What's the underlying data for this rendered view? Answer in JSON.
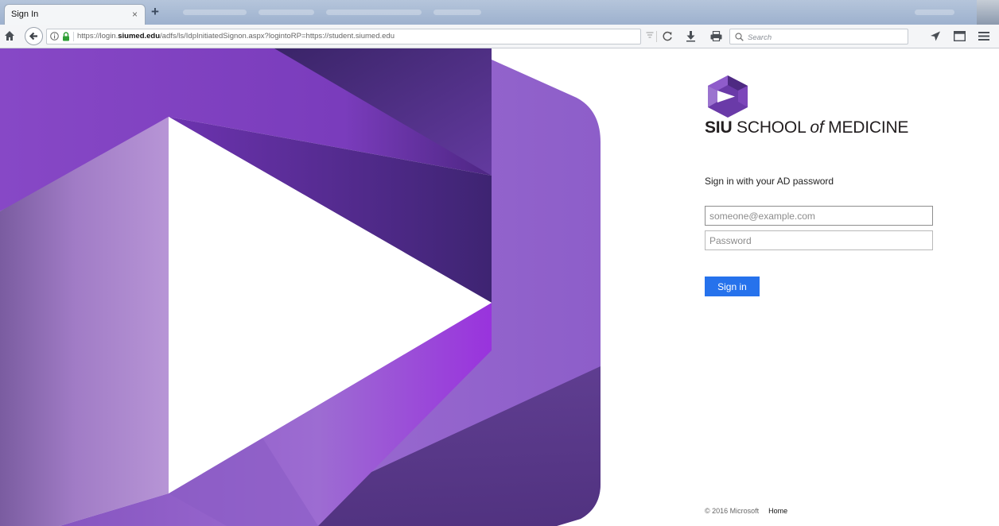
{
  "browser": {
    "tab": {
      "title": "Sign In",
      "close_glyph": "×"
    },
    "new_tab_glyph": "+",
    "address": {
      "scheme": "https://login.",
      "domain": "siumed.edu",
      "path": "/adfs/ls/IdpInitiatedSignon.aspx?logintoRP=https://student.siumed.edu"
    },
    "search": {
      "placeholder": "Search"
    },
    "icons": [
      "home-icon",
      "back-arrow-icon",
      "info-icon",
      "lock-icon",
      "filter-icon",
      "reload-icon",
      "download-icon",
      "print-icon",
      "search-icon",
      "send-icon",
      "sidebar-icon",
      "hamburger-menu-icon"
    ]
  },
  "brand": {
    "logo_part1": "SIU",
    "logo_part2": " SCHOOL ",
    "logo_part3": "of",
    "logo_part4": " MEDICINE",
    "accent_color": "#7b3fb8",
    "button_color": "#2672ec"
  },
  "form": {
    "heading": "Sign in with your AD password",
    "email_placeholder": "someone@example.com",
    "password_placeholder": "Password",
    "submit_label": "Sign in"
  },
  "footer": {
    "copyright": "© 2016 Microsoft",
    "home_link": "Home"
  }
}
